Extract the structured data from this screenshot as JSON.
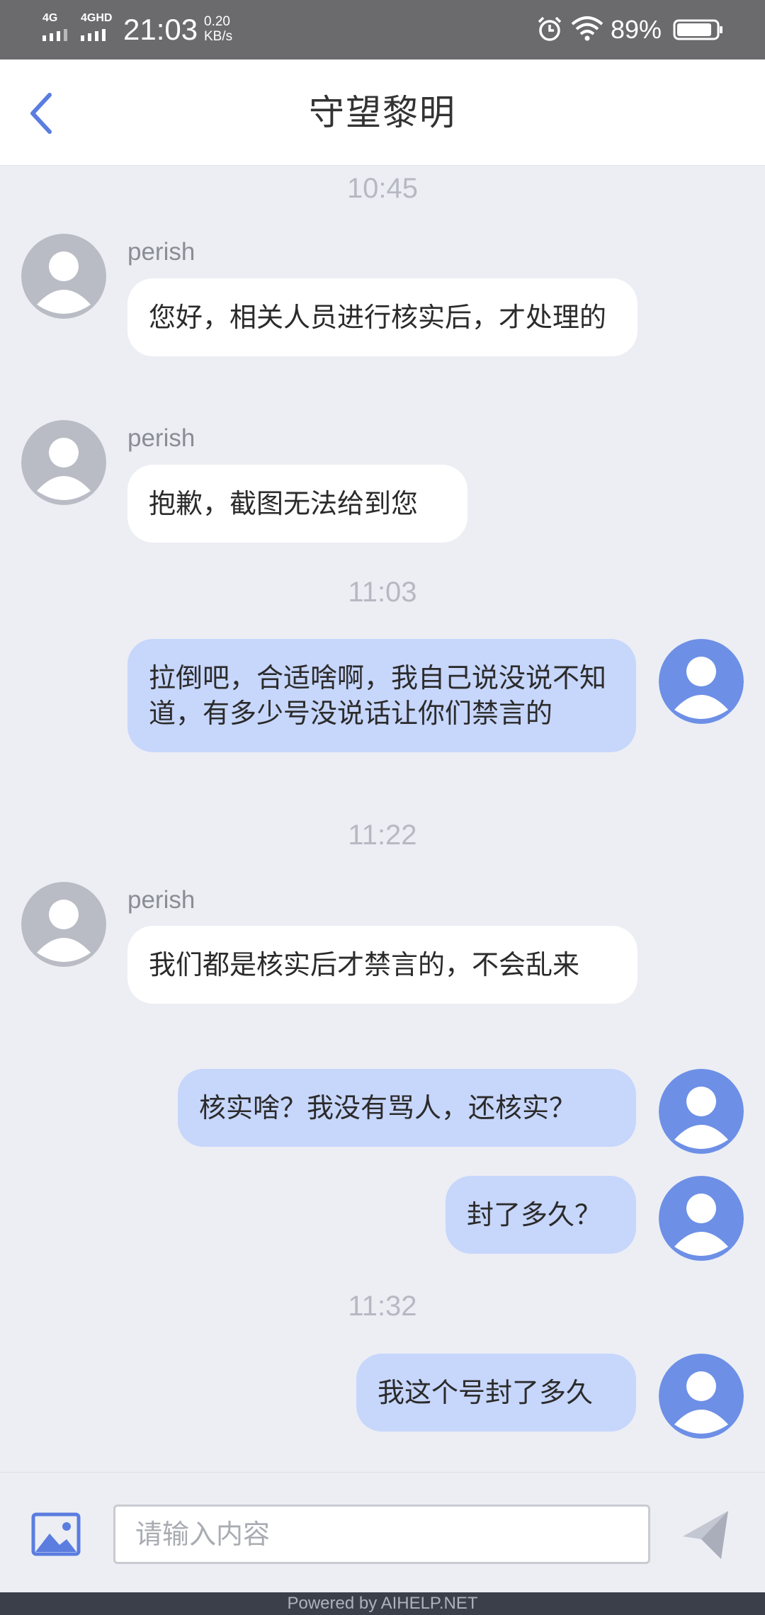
{
  "status_bar": {
    "network1": "4G",
    "network2": "4GHD",
    "time": "21:03",
    "speed_value": "0.20",
    "speed_unit": "KB/s",
    "battery_percent": "89%",
    "battery_level": 0.89
  },
  "header": {
    "title": "守望黎明",
    "back_icon": "chevron-left-icon"
  },
  "chat": {
    "times": [
      "10:45",
      "11:03",
      "11:22",
      "11:32"
    ],
    "messages": [
      {
        "direction": "in",
        "sender": "perish",
        "text": "您好，相关人员进行核实后，才处理的"
      },
      {
        "direction": "in",
        "sender": "perish",
        "text": "抱歉，截图无法给到您"
      },
      {
        "direction": "out",
        "text": "拉倒吧，合适啥啊，我自己说没说不知道，有多少号没说话让你们禁言的"
      },
      {
        "direction": "in",
        "sender": "perish",
        "text": "我们都是核实后才禁言的，不会乱来"
      },
      {
        "direction": "out",
        "text": "核实啥？我没有骂人，还核实？"
      },
      {
        "direction": "out",
        "text": "封了多久？"
      },
      {
        "direction": "out",
        "text": "我这个号封了多久"
      }
    ]
  },
  "composer": {
    "placeholder": "请输入内容",
    "image_icon": "image-icon",
    "send_icon": "send-icon"
  },
  "footer": {
    "text": "Powered by AIHELP.NET"
  },
  "colors": {
    "accent": "#5b7de0",
    "bubble_out": "#c7d6fb",
    "bubble_in": "#ffffff",
    "avatar_in": "#b9bcc4",
    "avatar_out": "#6d8fe6",
    "background": "#eceef4"
  }
}
